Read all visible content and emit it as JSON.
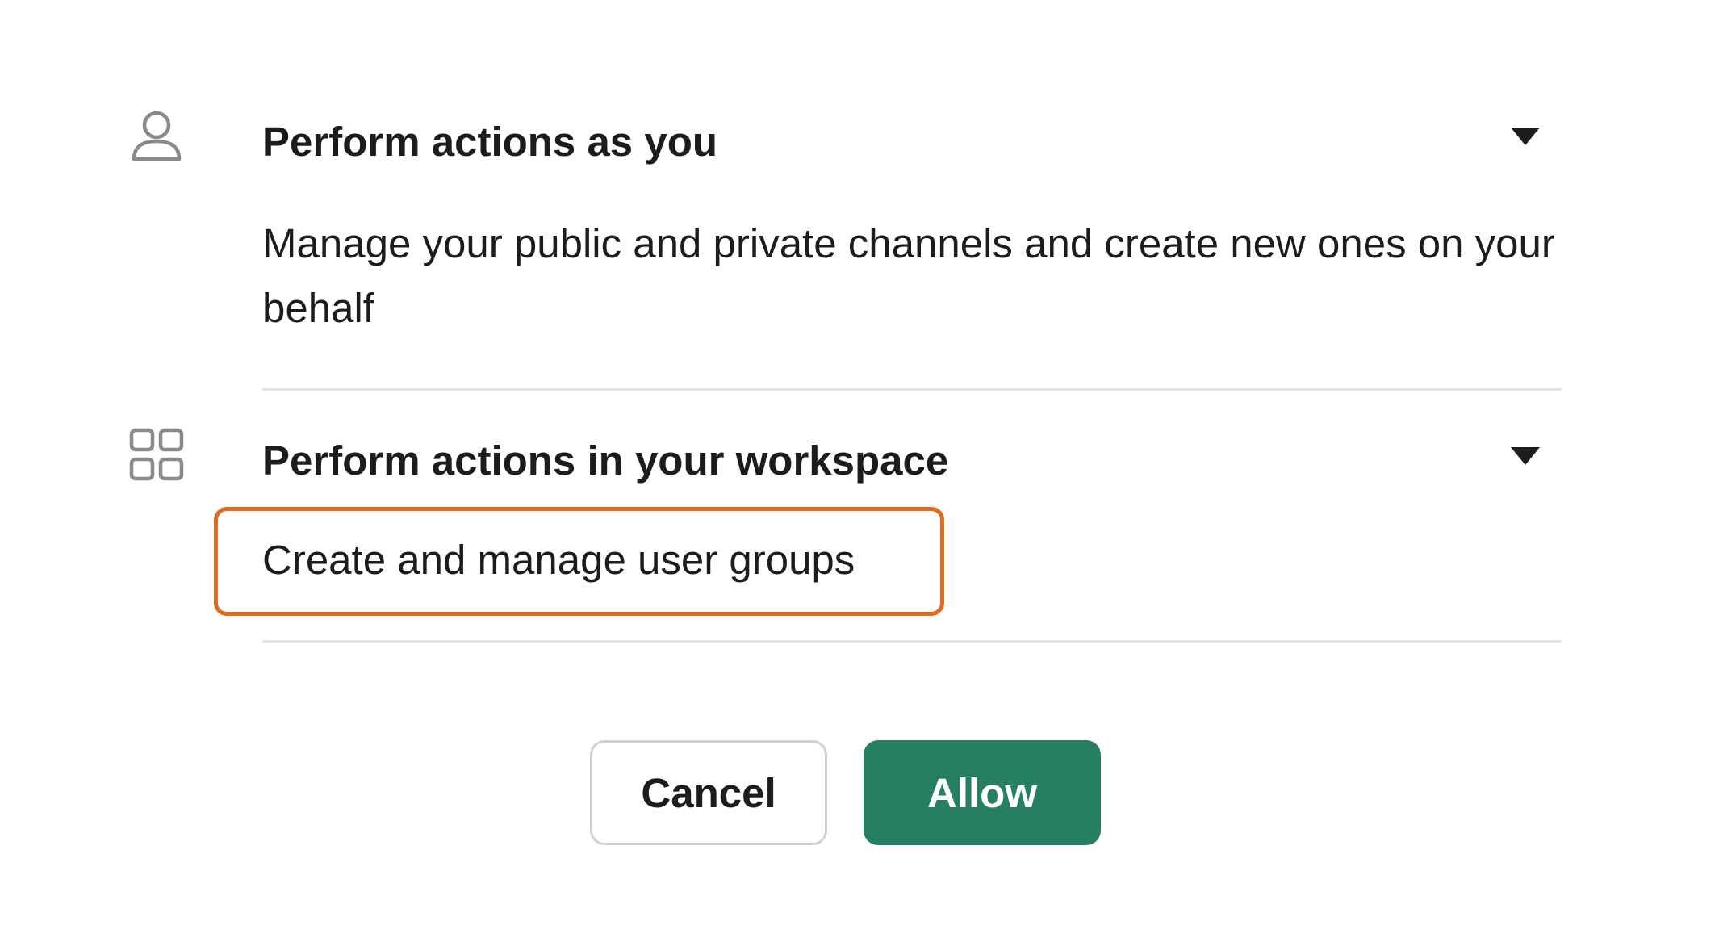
{
  "permissions": [
    {
      "icon": "person-icon",
      "title": "Perform actions as you",
      "description": "Manage your public and private channels and create new ones on your behalf"
    },
    {
      "icon": "grid-icon",
      "title": "Perform actions in your workspace",
      "description": "Create and manage user groups"
    }
  ],
  "buttons": {
    "cancel_label": "Cancel",
    "allow_label": "Allow"
  },
  "colors": {
    "allow_button": "#268060",
    "highlight_border": "#e06c1f",
    "divider": "#e4e4e4",
    "text": "#1d1c1d",
    "icon": "#8a8a8a"
  }
}
